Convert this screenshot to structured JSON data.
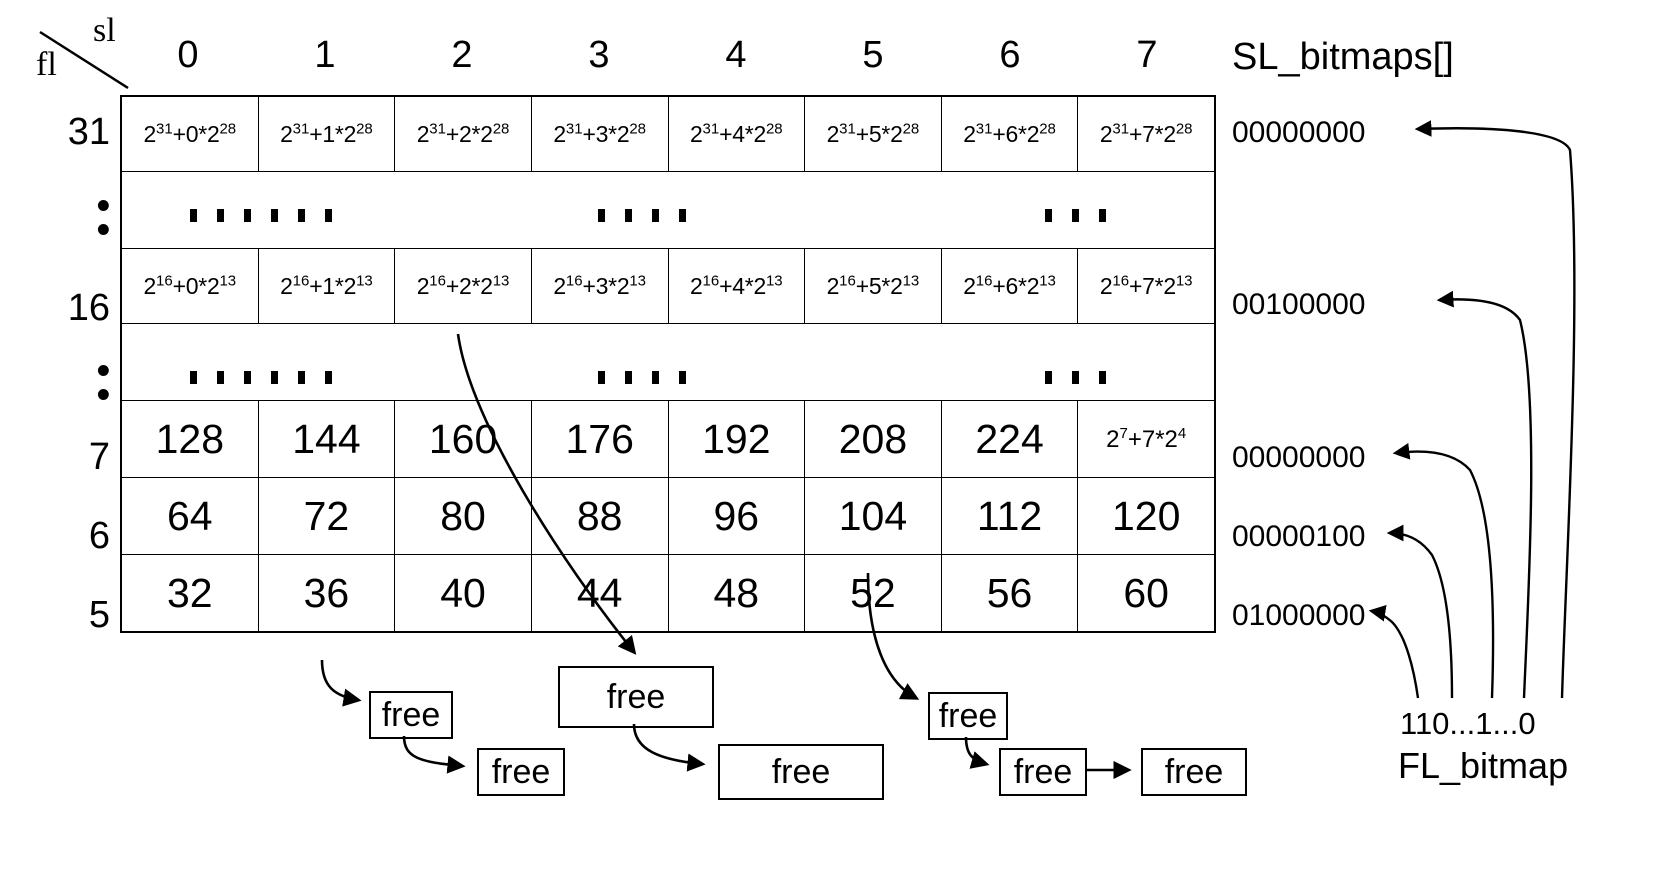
{
  "axes": {
    "sl_label": "sl",
    "fl_label": "fl",
    "col_headers": [
      "0",
      "1",
      "2",
      "3",
      "4",
      "5",
      "6",
      "7"
    ],
    "row_labels": [
      "31",
      "⋮",
      "16",
      "⋮",
      "7",
      "6",
      "5"
    ]
  },
  "table": {
    "rows": [
      {
        "fl": "31",
        "kind": "pow",
        "cells": [
          {
            "base": "2",
            "base_exp": "31",
            "mult": "0",
            "term": "2",
            "term_exp": "28",
            "text": "2^31+0*2^28",
            "gray": false
          },
          {
            "base": "2",
            "base_exp": "31",
            "mult": "1",
            "term": "2",
            "term_exp": "28",
            "text": "2^31+1*2^28",
            "gray": false
          },
          {
            "base": "2",
            "base_exp": "31",
            "mult": "2",
            "term": "2",
            "term_exp": "28",
            "text": "2^31+2*2^28",
            "gray": false
          },
          {
            "base": "2",
            "base_exp": "31",
            "mult": "3",
            "term": "2",
            "term_exp": "28",
            "text": "2^31+3*2^28",
            "gray": false
          },
          {
            "base": "2",
            "base_exp": "31",
            "mult": "4",
            "term": "2",
            "term_exp": "28",
            "text": "2^31+4*2^28",
            "gray": false
          },
          {
            "base": "2",
            "base_exp": "31",
            "mult": "5",
            "term": "2",
            "term_exp": "28",
            "text": "2^31+5*2^28",
            "gray": false
          },
          {
            "base": "2",
            "base_exp": "31",
            "mult": "6",
            "term": "2",
            "term_exp": "28",
            "text": "2^31+6*2^28",
            "gray": false
          },
          {
            "base": "2",
            "base_exp": "31",
            "mult": "7",
            "term": "2",
            "term_exp": "28",
            "text": "2^31+7*2^28",
            "gray": false
          }
        ]
      },
      {
        "fl": "⋮",
        "kind": "dots",
        "cells": []
      },
      {
        "fl": "16",
        "kind": "pow",
        "cells": [
          {
            "base": "2",
            "base_exp": "16",
            "mult": "0",
            "term": "2",
            "term_exp": "13",
            "text": "2^16+0*2^13",
            "gray": false
          },
          {
            "base": "2",
            "base_exp": "16",
            "mult": "1",
            "term": "2",
            "term_exp": "13",
            "text": "2^16+1*2^13",
            "gray": false
          },
          {
            "base": "2",
            "base_exp": "16",
            "mult": "2",
            "term": "2",
            "term_exp": "13",
            "text": "2^16+2*2^13",
            "gray": true
          },
          {
            "base": "2",
            "base_exp": "16",
            "mult": "3",
            "term": "2",
            "term_exp": "13",
            "text": "2^16+3*2^13",
            "gray": false
          },
          {
            "base": "2",
            "base_exp": "16",
            "mult": "4",
            "term": "2",
            "term_exp": "13",
            "text": "2^16+4*2^13",
            "gray": false
          },
          {
            "base": "2",
            "base_exp": "16",
            "mult": "5",
            "term": "2",
            "term_exp": "13",
            "text": "2^16+5*2^13",
            "gray": false
          },
          {
            "base": "2",
            "base_exp": "16",
            "mult": "6",
            "term": "2",
            "term_exp": "13",
            "text": "2^16+6*2^13",
            "gray": false
          },
          {
            "base": "2",
            "base_exp": "16",
            "mult": "7",
            "term": "2",
            "term_exp": "13",
            "text": "2^16+7*2^13",
            "gray": false
          }
        ]
      },
      {
        "fl": "⋮",
        "kind": "dots",
        "cells": []
      },
      {
        "fl": "7",
        "kind": "num",
        "cells": [
          {
            "text": "128",
            "gray": false,
            "small": false
          },
          {
            "text": "144",
            "gray": false,
            "small": false
          },
          {
            "text": "160",
            "gray": false,
            "small": false
          },
          {
            "text": "176",
            "gray": false,
            "small": false
          },
          {
            "text": "192",
            "gray": false,
            "small": false
          },
          {
            "text": "208",
            "gray": false,
            "small": false
          },
          {
            "text": "224",
            "gray": false,
            "small": false
          },
          {
            "text": "2^7+7*2^4",
            "gray": false,
            "small": true,
            "base": "2",
            "base_exp": "7",
            "mult": "7",
            "term": "2",
            "term_exp": "4"
          }
        ]
      },
      {
        "fl": "6",
        "kind": "num",
        "cells": [
          {
            "text": "64",
            "gray": false,
            "small": false
          },
          {
            "text": "72",
            "gray": false,
            "small": false
          },
          {
            "text": "80",
            "gray": false,
            "small": false
          },
          {
            "text": "88",
            "gray": false,
            "small": false
          },
          {
            "text": "96",
            "gray": false,
            "small": false
          },
          {
            "text": "104",
            "gray": true,
            "small": false
          },
          {
            "text": "112",
            "gray": false,
            "small": false
          },
          {
            "text": "120",
            "gray": false,
            "small": false
          }
        ]
      },
      {
        "fl": "5",
        "kind": "num",
        "cells": [
          {
            "text": "32",
            "gray": false,
            "small": false
          },
          {
            "text": "36",
            "gray": true,
            "small": false
          },
          {
            "text": "40",
            "gray": false,
            "small": false
          },
          {
            "text": "44",
            "gray": false,
            "small": false
          },
          {
            "text": "48",
            "gray": false,
            "small": false
          },
          {
            "text": "52",
            "gray": false,
            "small": false
          },
          {
            "text": "56",
            "gray": false,
            "small": false
          },
          {
            "text": "60",
            "gray": false,
            "small": false
          }
        ]
      }
    ]
  },
  "bitmaps": {
    "title": "SL_bitmaps[]",
    "rows": [
      {
        "fl": "31",
        "value": "00000000"
      },
      {
        "fl": "16",
        "value": "00100000"
      },
      {
        "fl": "7",
        "value": "00000000"
      },
      {
        "fl": "6",
        "value": "00000100"
      },
      {
        "fl": "5",
        "value": "01000000"
      }
    ],
    "fl_bitmap_value": "110...1...0",
    "fl_bitmap_label": "FL_bitmap"
  },
  "free_blocks": [
    {
      "id": "free-a1",
      "label": "free"
    },
    {
      "id": "free-a2",
      "label": "free"
    },
    {
      "id": "free-b1",
      "label": "free"
    },
    {
      "id": "free-b2",
      "label": "free"
    },
    {
      "id": "free-c1",
      "label": "free"
    },
    {
      "id": "free-c2",
      "label": "free"
    },
    {
      "id": "free-c3",
      "label": "free"
    }
  ],
  "colors": {
    "highlight": "#cfcfcf",
    "line": "#000000",
    "background": "#ffffff"
  }
}
